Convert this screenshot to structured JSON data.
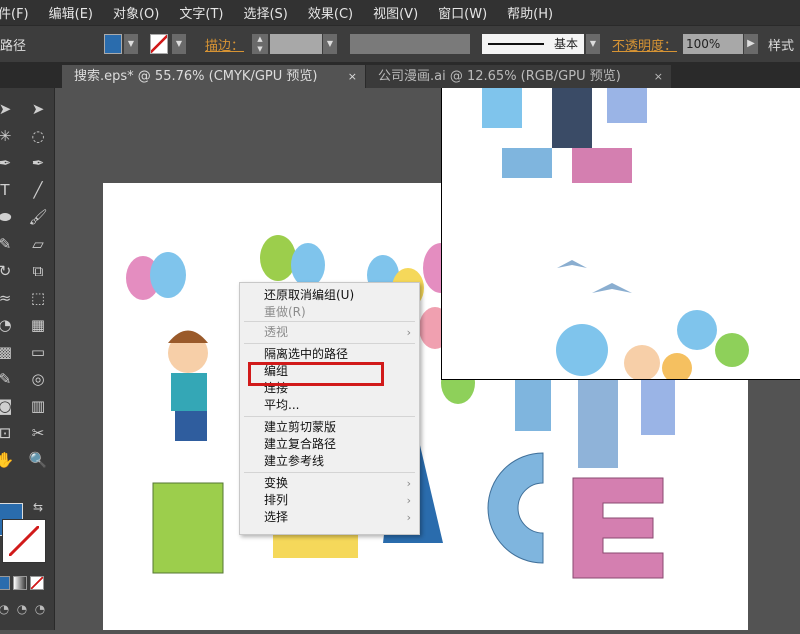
{
  "menubar": [
    "件(F)",
    "编辑(E)",
    "对象(O)",
    "文字(T)",
    "选择(S)",
    "效果(C)",
    "视图(V)",
    "窗口(W)",
    "帮助(H)"
  ],
  "control": {
    "selection_label": "路径",
    "fill_color": "#2a6cad",
    "stroke_label": "描边：",
    "stroke_profile": "基本",
    "opacity_label": "不透明度：",
    "opacity_value": "100%",
    "style_label": "样式"
  },
  "tabs": [
    {
      "label": "搜索.eps* @ 55.76% (CMYK/GPU 预览)",
      "close": "×",
      "active": true
    },
    {
      "label": "公司漫画.ai @ 12.65% (RGB/GPU 预览)",
      "close": "×",
      "active": false
    }
  ],
  "tools": [
    "selection",
    "direct-selection",
    "magic-wand",
    "lasso",
    "pen",
    "curvature",
    "type",
    "line",
    "ellipse",
    "paintbrush",
    "shaper",
    "eraser",
    "rotate",
    "scale",
    "warp",
    "free-transform",
    "shape-builder",
    "perspective-grid",
    "mesh",
    "gradient",
    "eyedropper",
    "blend",
    "symbol-sprayer",
    "column-graph",
    "artboard",
    "slice",
    "hand",
    "zoom"
  ],
  "context_menu": {
    "items": [
      {
        "label": "还原取消编组(U)",
        "disabled": false
      },
      {
        "label": "重做(R)",
        "disabled": true
      },
      {
        "label": "透视",
        "disabled": true,
        "submenu": true
      },
      {
        "label": "隔离选中的路径",
        "disabled": false
      },
      {
        "label": "编组",
        "disabled": false,
        "highlighted": true
      },
      {
        "label": "连接",
        "disabled": false
      },
      {
        "label": "平均...",
        "disabled": false
      },
      {
        "label": "建立剪切蒙版",
        "disabled": false
      },
      {
        "label": "建立复合路径",
        "disabled": false
      },
      {
        "label": "建立参考线",
        "disabled": false
      },
      {
        "label": "变换",
        "disabled": false,
        "submenu": true
      },
      {
        "label": "排列",
        "disabled": false,
        "submenu": true
      },
      {
        "label": "选择",
        "disabled": false,
        "submenu": true
      }
    ],
    "submenu_arrow": "›"
  },
  "colors": {
    "highlight_box": "#d11a1a",
    "accent_orange": "#d79434"
  }
}
